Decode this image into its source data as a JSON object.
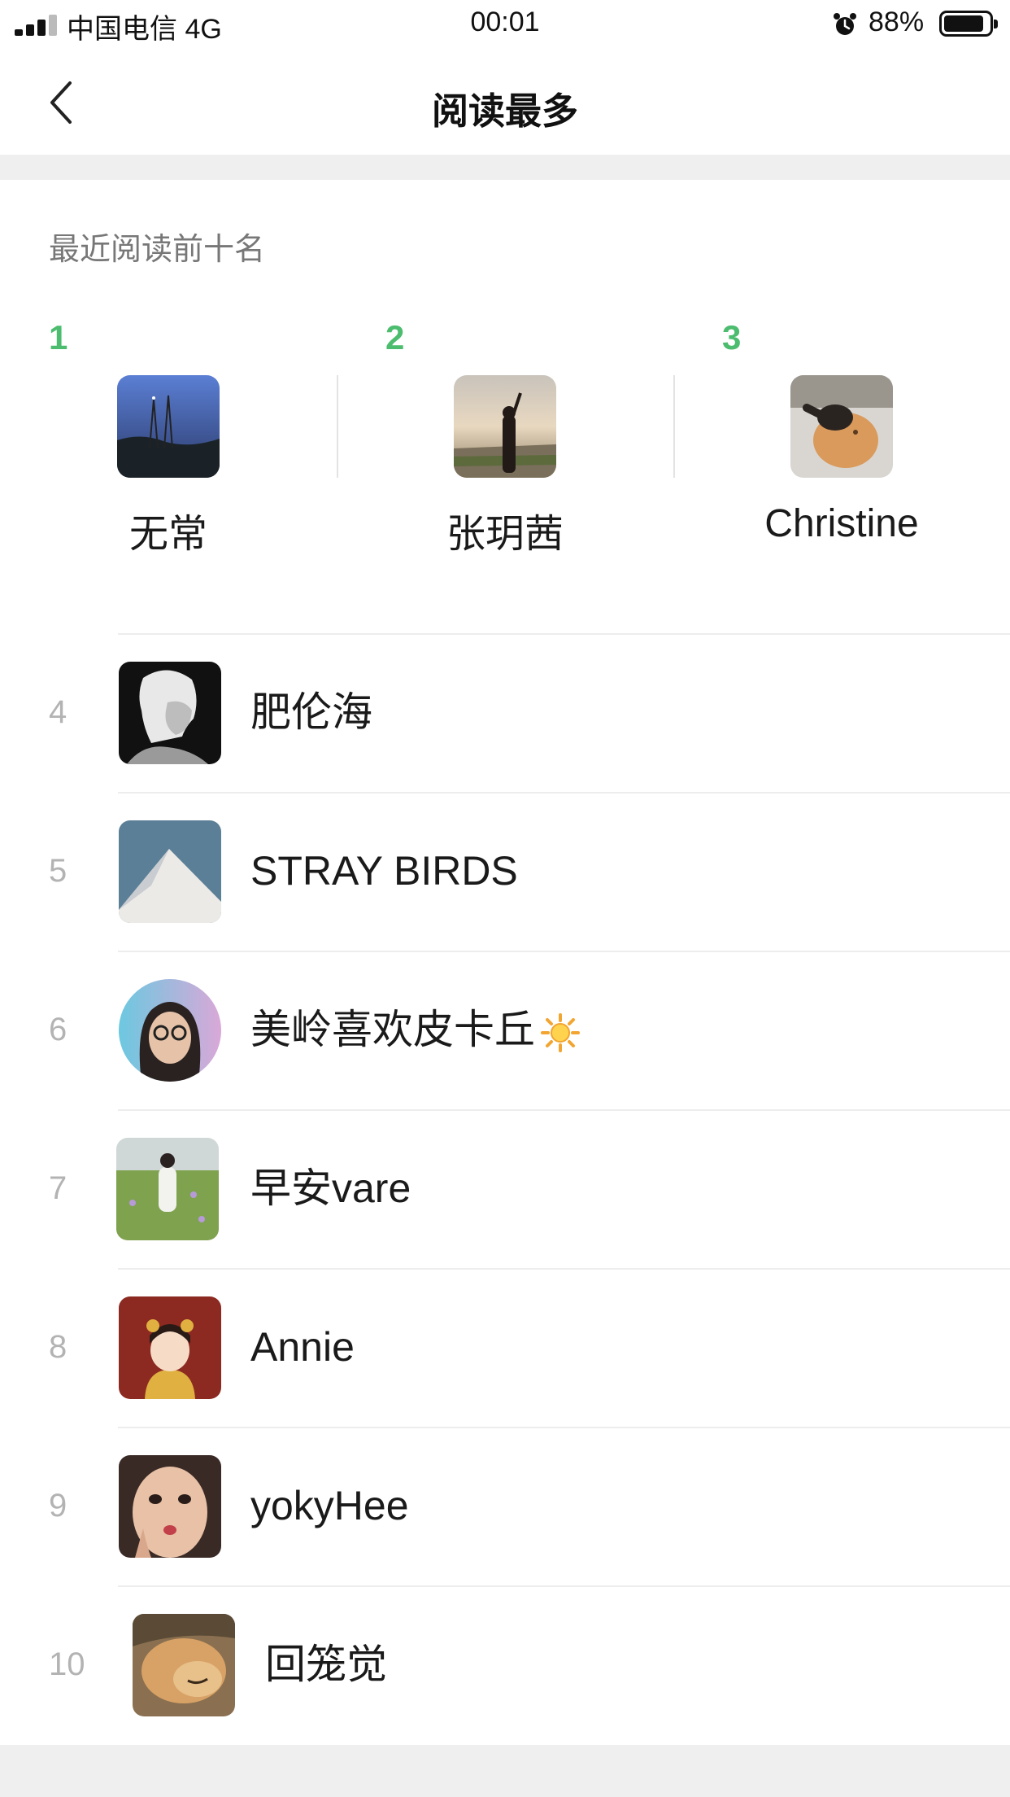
{
  "status_bar": {
    "carrier": "中国电信 4G",
    "time": "00:01",
    "battery_percent": "88%",
    "battery_level": 0.88,
    "signal_bars": 3,
    "alarm_icon": "alarm-clock-icon"
  },
  "nav": {
    "title": "阅读最多",
    "back_icon": "chevron-left-icon"
  },
  "section": {
    "title": "最近阅读前十名"
  },
  "top3": [
    {
      "rank": "1",
      "name": "无常"
    },
    {
      "rank": "2",
      "name": "张玥茜"
    },
    {
      "rank": "3",
      "name": "Christine"
    }
  ],
  "list": [
    {
      "rank": "4",
      "name": "肥伦海"
    },
    {
      "rank": "5",
      "name": "STRAY BIRDS"
    },
    {
      "rank": "6",
      "name": "美岭喜欢皮卡丘",
      "emoji_icon": "sun-icon"
    },
    {
      "rank": "7",
      "name": "早安vare"
    },
    {
      "rank": "8",
      "name": "Annie"
    },
    {
      "rank": "9",
      "name": "yokyHee"
    },
    {
      "rank": "10",
      "name": "回笼觉"
    }
  ],
  "colors": {
    "rank_top": "#4cbc6e",
    "rank_other": "#b3b3b3",
    "background": "#efefef"
  }
}
